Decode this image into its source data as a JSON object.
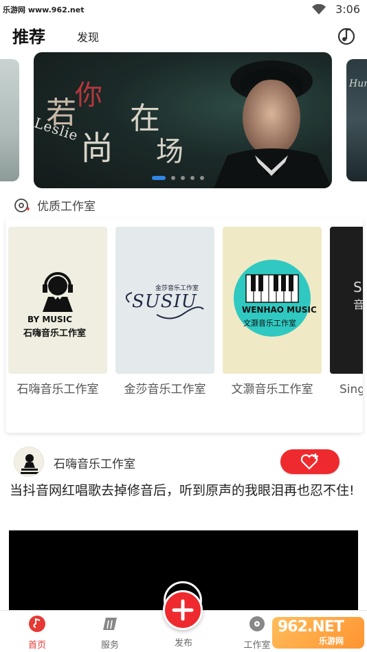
{
  "status_bar": {
    "watermark": "乐游网 www.962.net",
    "time": "3:06"
  },
  "header": {
    "tabs": [
      {
        "label": "推荐",
        "active": true
      },
      {
        "label": "发现",
        "active": false
      }
    ]
  },
  "banner": {
    "title_chars": [
      "若",
      "你",
      "尚",
      "在",
      "场"
    ],
    "subtitle": "Leslie",
    "right_peek_text": "Hun",
    "page_count": 5,
    "active_page": 1
  },
  "studios_section": {
    "title": "优质工作室",
    "cards": [
      {
        "name": "石嗨音乐工作室",
        "logo_line1": "BY MUSIC",
        "logo_line2": "石嗨音乐工作室",
        "bg": "#efeee0"
      },
      {
        "name": "金莎音乐工作室",
        "logo_line1": "金莎音乐工作室",
        "logo_line2": "SUSIU",
        "bg": "#e4e9ec"
      },
      {
        "name": "文灏音乐工作室",
        "logo_line1": "WENHAO MUSIC",
        "logo_line2": "文灏音乐工作室",
        "bg": "#efe9c6"
      },
      {
        "name": "Sing",
        "logo_line1": "S",
        "logo_line2": "音",
        "bg": "#1d1d1d"
      }
    ]
  },
  "post": {
    "author": "石嗨音乐工作室",
    "title": "当抖音网红唱歌去掉修音后，听到原声的我眼泪再也忍不住!"
  },
  "bottom_nav": {
    "items": [
      {
        "label": "首页",
        "active": true
      },
      {
        "label": "服务",
        "active": false
      },
      {
        "label": "发布",
        "active": false
      },
      {
        "label": "工作室",
        "active": false
      }
    ]
  },
  "watermark_badge": {
    "big": "962.NET",
    "small": "乐游网"
  },
  "colors": {
    "accent": "#ef2a2e",
    "pager_active": "#2f86e6"
  }
}
